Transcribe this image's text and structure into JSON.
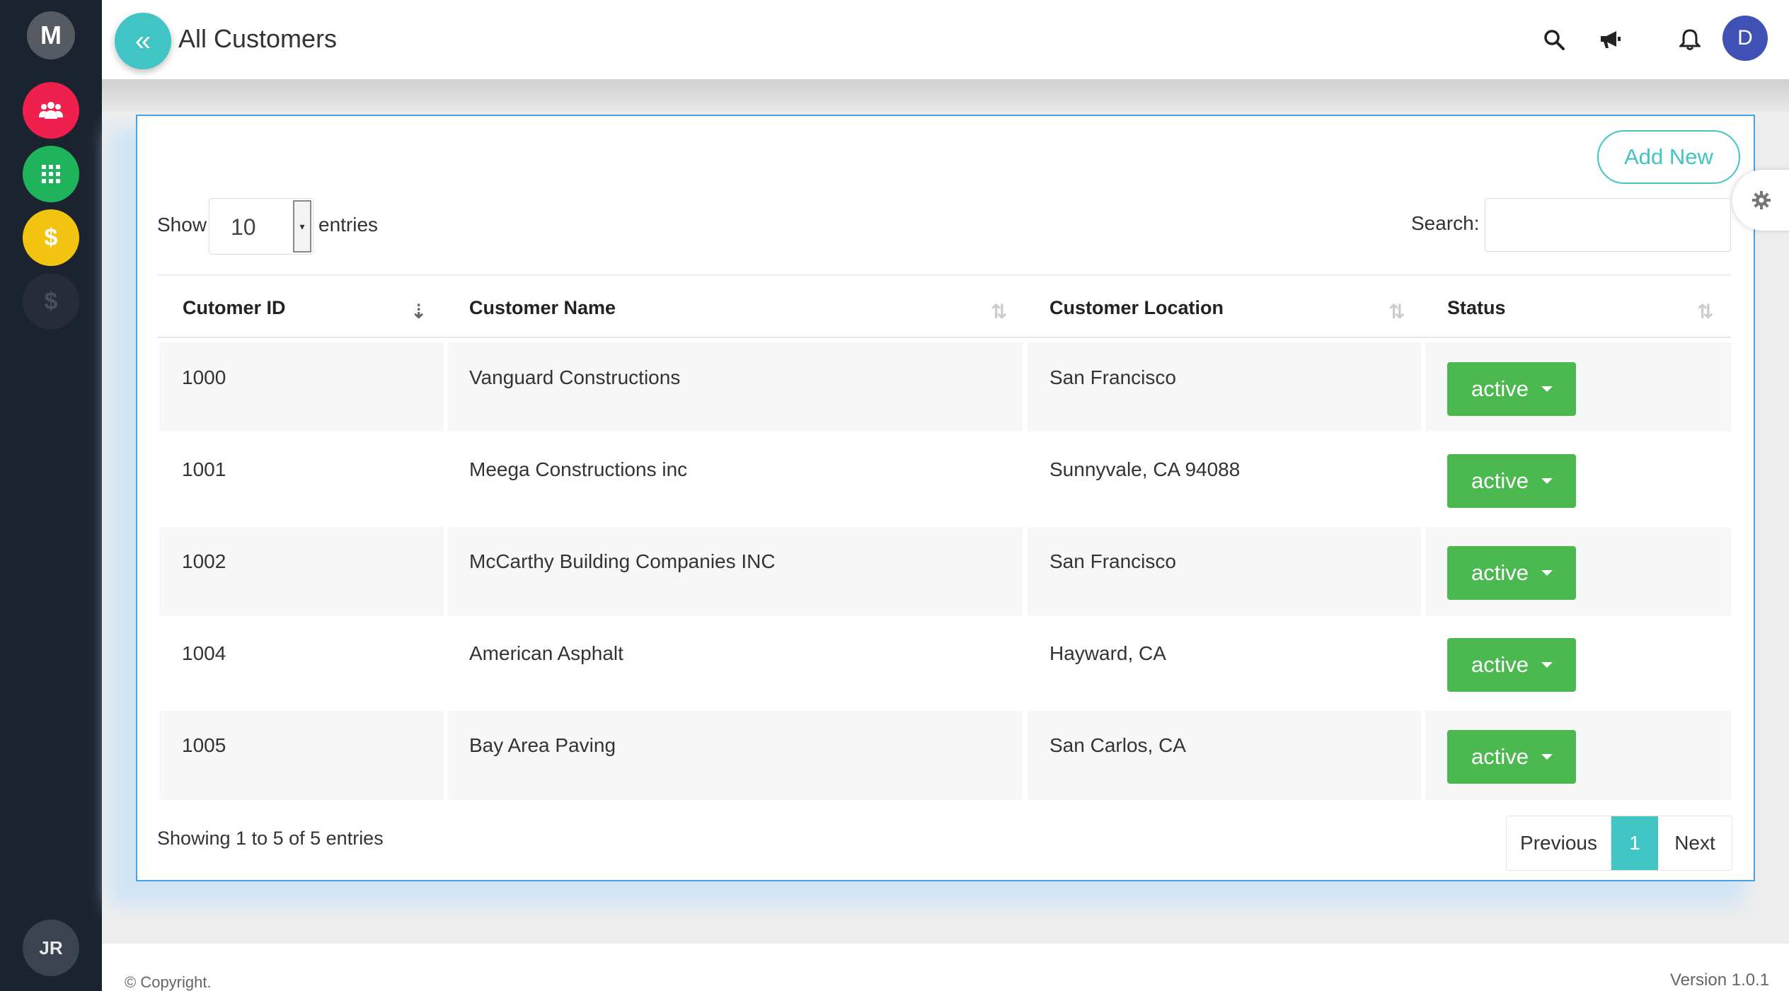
{
  "sidebar": {
    "logo_letter": "M",
    "items": [
      {
        "icon": "users-icon",
        "color": "#ef1f4e"
      },
      {
        "icon": "apps-grid-icon",
        "color": "#1fb35b"
      },
      {
        "icon": "dollar-icon",
        "label": "$",
        "color": "#f2c40f"
      },
      {
        "icon": "dollar-icon",
        "label": "$",
        "color": "#262d39"
      }
    ],
    "user_initials": "JR"
  },
  "header": {
    "back_icon": "«",
    "title": "All Customers",
    "avatar_letter": "D"
  },
  "toolbar": {
    "add_new_label": "Add New",
    "show_label": "Show",
    "entries_value": "10",
    "entries_label": "entries",
    "search_label": "Search:",
    "search_value": ""
  },
  "table": {
    "columns": [
      "Cutomer ID",
      "Customer Name",
      "Customer Location",
      "Status"
    ],
    "rows": [
      {
        "id": "1000",
        "name": "Vanguard Constructions",
        "location": "San Francisco",
        "status": "active"
      },
      {
        "id": "1001",
        "name": "Meega Constructions inc",
        "location": "Sunnyvale, CA 94088",
        "status": "active"
      },
      {
        "id": "1002",
        "name": "McCarthy Building Companies INC",
        "location": "San Francisco",
        "status": "active"
      },
      {
        "id": "1004",
        "name": "American Asphalt",
        "location": "Hayward, CA",
        "status": "active"
      },
      {
        "id": "1005",
        "name": "Bay Area Paving",
        "location": "San Carlos, CA",
        "status": "active"
      }
    ]
  },
  "pagination": {
    "info": "Showing 1 to 5 of 5 entries",
    "previous": "Previous",
    "current": "1",
    "next": "Next"
  },
  "footer": {
    "copyright": "© Copyright.",
    "version": "Version 1.0.1"
  },
  "colors": {
    "accent": "#40c4c4",
    "status_active": "#4cb950",
    "sidebar_bg": "#1b2230"
  }
}
